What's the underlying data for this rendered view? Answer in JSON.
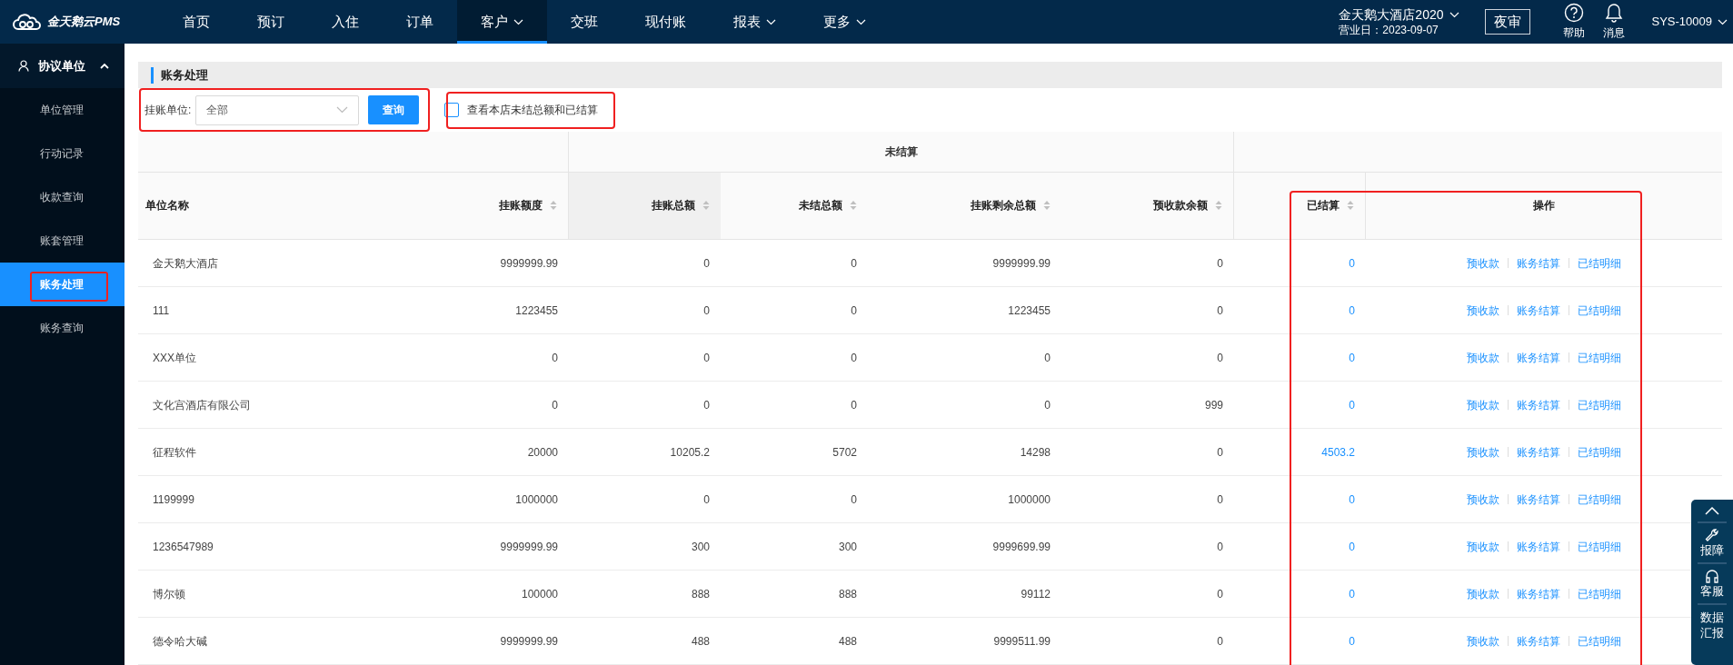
{
  "top_nav": {
    "logo": "金天鹅云PMS",
    "items": [
      {
        "label": "首页",
        "selected": false,
        "has_menu": false
      },
      {
        "label": "预订",
        "selected": false,
        "has_menu": false
      },
      {
        "label": "入住",
        "selected": false,
        "has_menu": false
      },
      {
        "label": "订单",
        "selected": false,
        "has_menu": false
      },
      {
        "label": "客户",
        "selected": true,
        "has_menu": true
      },
      {
        "label": "交班",
        "selected": false,
        "has_menu": false
      },
      {
        "label": "现付账",
        "selected": false,
        "has_menu": false
      },
      {
        "label": "报表",
        "selected": false,
        "has_menu": true
      },
      {
        "label": "更多",
        "selected": false,
        "has_menu": true
      }
    ],
    "hotel": "金天鹅大酒店2020",
    "business_date": "营业日：2023-09-07",
    "night_audit": "夜审",
    "help": "帮助",
    "messages": "消息",
    "user": "SYS-10009"
  },
  "sidebar": {
    "group": {
      "label": "协议单位",
      "expanded": true
    },
    "items": [
      {
        "label": "单位管理",
        "selected": false
      },
      {
        "label": "行动记录",
        "selected": false
      },
      {
        "label": "收款查询",
        "selected": false
      },
      {
        "label": "账套管理",
        "selected": false
      },
      {
        "label": "账务处理",
        "selected": true
      },
      {
        "label": "账务查询",
        "selected": false
      }
    ]
  },
  "page_title": "账务处理",
  "filter": {
    "label": "挂账单位:",
    "value": "全部",
    "query_button": "查询"
  },
  "checkbox": {
    "label": "查看本店未结总额和已结算",
    "checked": false
  },
  "table": {
    "group_header": "未结算",
    "columns": [
      {
        "label": "单位名称",
        "sortable": false,
        "highlighted": false
      },
      {
        "label": "挂账额度",
        "sortable": true,
        "highlighted": false
      },
      {
        "label": "挂账总额",
        "sortable": true,
        "highlighted": true
      },
      {
        "label": "未结总额",
        "sortable": true,
        "highlighted": false
      },
      {
        "label": "挂账剩余总额",
        "sortable": true,
        "highlighted": false
      },
      {
        "label": "预收款余额",
        "sortable": true,
        "highlighted": false
      },
      {
        "label": "已结算",
        "sortable": true,
        "highlighted": false
      },
      {
        "label": "操作",
        "sortable": false,
        "highlighted": false
      }
    ],
    "rows": [
      {
        "cells": [
          "金天鹅大酒店",
          "9999999.99",
          "0",
          "0",
          "9999999.99",
          "0",
          "0"
        ],
        "actions": [
          "预收款",
          "账务结算",
          "已结明细"
        ]
      },
      {
        "cells": [
          "111",
          "1223455",
          "0",
          "0",
          "1223455",
          "0",
          "0"
        ],
        "actions": [
          "预收款",
          "账务结算",
          "已结明细"
        ]
      },
      {
        "cells": [
          "XXX单位",
          "0",
          "0",
          "0",
          "0",
          "0",
          "0"
        ],
        "actions": [
          "预收款",
          "账务结算",
          "已结明细"
        ]
      },
      {
        "cells": [
          "文化宫酒店有限公司",
          "0",
          "0",
          "0",
          "0",
          "999",
          "0"
        ],
        "actions": [
          "预收款",
          "账务结算",
          "已结明细"
        ]
      },
      {
        "cells": [
          "征程软件",
          "20000",
          "10205.2",
          "5702",
          "14298",
          "0",
          "4503.2"
        ],
        "actions": [
          "预收款",
          "账务结算",
          "已结明细"
        ]
      },
      {
        "cells": [
          "1199999",
          "1000000",
          "0",
          "0",
          "1000000",
          "0",
          "0"
        ],
        "actions": [
          "预收款",
          "账务结算",
          "已结明细"
        ]
      },
      {
        "cells": [
          "1236547989",
          "9999999.99",
          "300",
          "300",
          "9999699.99",
          "0",
          "0"
        ],
        "actions": [
          "预收款",
          "账务结算",
          "已结明细"
        ]
      },
      {
        "cells": [
          "博尔顿",
          "100000",
          "888",
          "888",
          "99112",
          "0",
          "0"
        ],
        "actions": [
          "预收款",
          "账务结算",
          "已结明细"
        ]
      },
      {
        "cells": [
          "德令哈大碱",
          "9999999.99",
          "488",
          "488",
          "9999511.99",
          "0",
          "0"
        ],
        "actions": [
          "预收款",
          "账务结算",
          "已结明细"
        ]
      }
    ]
  },
  "float_panel": [
    {
      "kind": "top"
    },
    {
      "kind": "wrench",
      "label": "报障"
    },
    {
      "kind": "headset",
      "label": "客服"
    },
    {
      "kind": "text",
      "label": "数据汇报"
    }
  ]
}
